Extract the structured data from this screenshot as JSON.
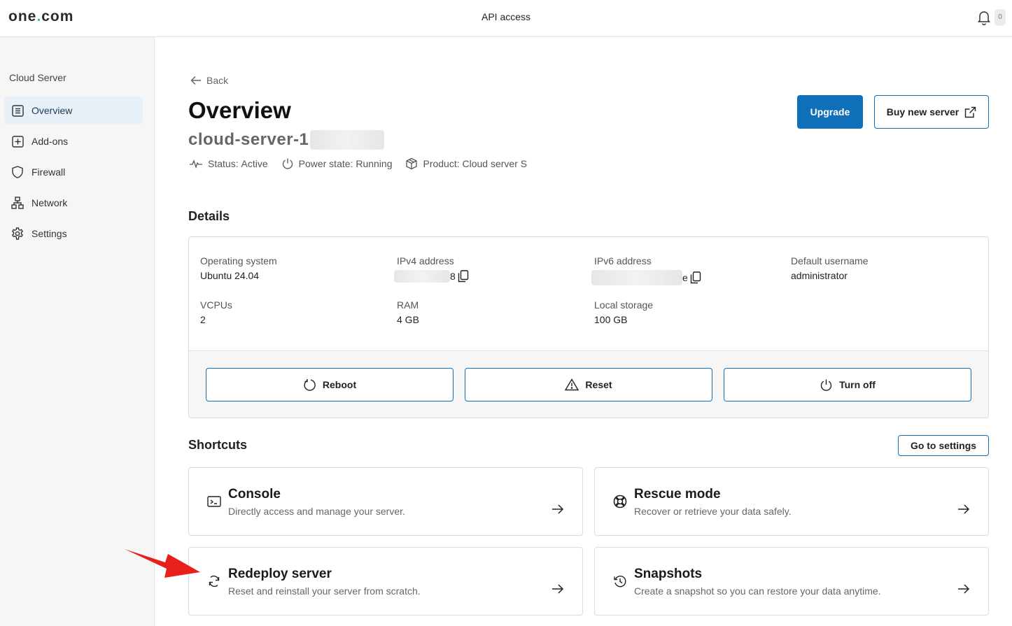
{
  "header": {
    "logo_text": "one",
    "logo_dot": ".",
    "logo_suffix": "com",
    "center_link": "API access",
    "notification_count": "0"
  },
  "sidebar": {
    "title": "Cloud Server",
    "items": [
      {
        "label": "Overview",
        "icon": "list-icon"
      },
      {
        "label": "Add-ons",
        "icon": "plus-square-icon"
      },
      {
        "label": "Firewall",
        "icon": "shield-icon"
      },
      {
        "label": "Network",
        "icon": "network-icon"
      },
      {
        "label": "Settings",
        "icon": "gear-icon"
      }
    ]
  },
  "page": {
    "back_label": "Back",
    "title": "Overview",
    "server_name": "cloud-server-1",
    "status_label": "Status:",
    "status_value": "Active",
    "power_label": "Power state:",
    "power_value": "Running",
    "product_label": "Product:",
    "product_value": "Cloud server S",
    "upgrade_label": "Upgrade",
    "buy_label": "Buy new server"
  },
  "details": {
    "heading": "Details",
    "os_label": "Operating system",
    "os_value": "Ubuntu 24.04",
    "ipv4_label": "IPv4 address",
    "ipv4_visible_tail": "8",
    "ipv6_label": "IPv6 address",
    "ipv6_visible_tail": "e",
    "username_label": "Default username",
    "username_value": "administrator",
    "vcpus_label": "VCPUs",
    "vcpus_value": "2",
    "ram_label": "RAM",
    "ram_value": "4 GB",
    "storage_label": "Local storage",
    "storage_value": "100 GB",
    "reboot_label": "Reboot",
    "reset_label": "Reset",
    "turnoff_label": "Turn off"
  },
  "shortcuts": {
    "heading": "Shortcuts",
    "settings_button": "Go to settings",
    "items": [
      {
        "title": "Console",
        "description": "Directly access and manage your server.",
        "icon": "terminal-icon"
      },
      {
        "title": "Rescue mode",
        "description": "Recover or retrieve your data safely.",
        "icon": "lifebuoy-icon"
      },
      {
        "title": "Redeploy server",
        "description": "Reset and reinstall your server from scratch.",
        "icon": "refresh-icon"
      },
      {
        "title": "Snapshots",
        "description": "Create a snapshot so you can restore your data anytime.",
        "icon": "history-icon"
      }
    ]
  },
  "colors": {
    "accent": "#0f6fb8",
    "annotation_arrow": "#e8201c",
    "sidebar_active_bg": "#e8f0f8"
  }
}
